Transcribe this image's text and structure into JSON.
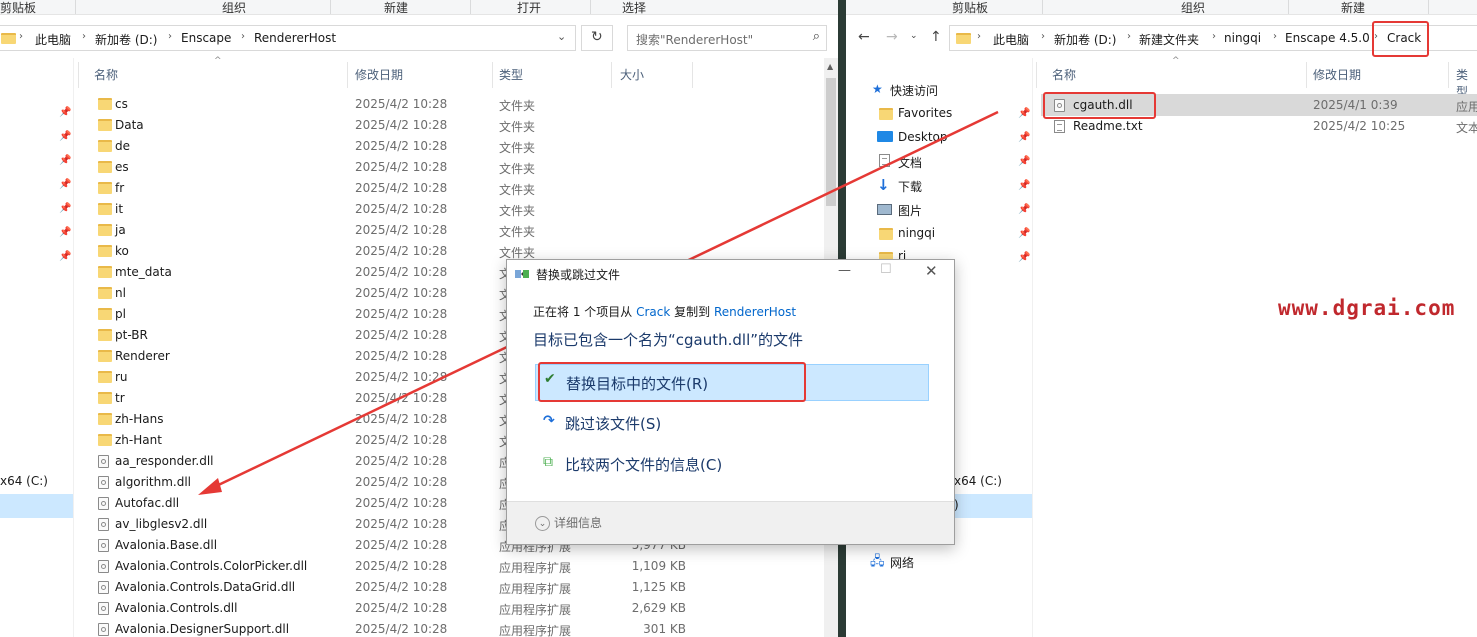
{
  "left_window": {
    "ribbon": [
      "剪贴板",
      "组织",
      "新建",
      "打开",
      "选择"
    ],
    "breadcrumb": [
      "此电脑",
      "新加卷 (D:)",
      "Enscape",
      "RendererHost"
    ],
    "search_placeholder": "搜索\"RendererHost\"",
    "columns": {
      "name": "名称",
      "date": "修改日期",
      "type": "类型",
      "size": "大小"
    },
    "files": [
      {
        "name": "cs",
        "date": "2025/4/2 10:28",
        "type": "文件夹",
        "size": "",
        "kind": "folder"
      },
      {
        "name": "Data",
        "date": "2025/4/2 10:28",
        "type": "文件夹",
        "size": "",
        "kind": "folder"
      },
      {
        "name": "de",
        "date": "2025/4/2 10:28",
        "type": "文件夹",
        "size": "",
        "kind": "folder"
      },
      {
        "name": "es",
        "date": "2025/4/2 10:28",
        "type": "文件夹",
        "size": "",
        "kind": "folder"
      },
      {
        "name": "fr",
        "date": "2025/4/2 10:28",
        "type": "文件夹",
        "size": "",
        "kind": "folder"
      },
      {
        "name": "it",
        "date": "2025/4/2 10:28",
        "type": "文件夹",
        "size": "",
        "kind": "folder"
      },
      {
        "name": "ja",
        "date": "2025/4/2 10:28",
        "type": "文件夹",
        "size": "",
        "kind": "folder"
      },
      {
        "name": "ko",
        "date": "2025/4/2 10:28",
        "type": "文件夹",
        "size": "",
        "kind": "folder"
      },
      {
        "name": "mte_data",
        "date": "2025/4/2 10:28",
        "type": "文件夹",
        "size": "",
        "kind": "folder"
      },
      {
        "name": "nl",
        "date": "2025/4/2 10:28",
        "type": "文",
        "size": "",
        "kind": "folder"
      },
      {
        "name": "pl",
        "date": "2025/4/2 10:28",
        "type": "文",
        "size": "",
        "kind": "folder"
      },
      {
        "name": "pt-BR",
        "date": "2025/4/2 10:28",
        "type": "文",
        "size": "",
        "kind": "folder"
      },
      {
        "name": "Renderer",
        "date": "2025/4/2 10:28",
        "type": "文",
        "size": "",
        "kind": "folder"
      },
      {
        "name": "ru",
        "date": "2025/4/2 10:28",
        "type": "文",
        "size": "",
        "kind": "folder"
      },
      {
        "name": "tr",
        "date": "2025/4/2 10:28",
        "type": "文",
        "size": "",
        "kind": "folder"
      },
      {
        "name": "zh-Hans",
        "date": "2025/4/2 10:28",
        "type": "文",
        "size": "",
        "kind": "folder"
      },
      {
        "name": "zh-Hant",
        "date": "2025/4/2 10:28",
        "type": "文",
        "size": "",
        "kind": "folder"
      },
      {
        "name": "aa_responder.dll",
        "date": "2025/4/2 10:28",
        "type": "应",
        "size": "",
        "kind": "dll"
      },
      {
        "name": "algorithm.dll",
        "date": "2025/4/2 10:28",
        "type": "应",
        "size": "",
        "kind": "dll"
      },
      {
        "name": "Autofac.dll",
        "date": "2025/4/2 10:28",
        "type": "应",
        "size": "",
        "kind": "dll"
      },
      {
        "name": "av_libglesv2.dll",
        "date": "2025/4/2 10:28",
        "type": "应",
        "size": "",
        "kind": "dll"
      },
      {
        "name": "Avalonia.Base.dll",
        "date": "2025/4/2 10:28",
        "type": "应用程序扩展",
        "size": "5,977 KB",
        "kind": "dll"
      },
      {
        "name": "Avalonia.Controls.ColorPicker.dll",
        "date": "2025/4/2 10:28",
        "type": "应用程序扩展",
        "size": "1,109 KB",
        "kind": "dll"
      },
      {
        "name": "Avalonia.Controls.DataGrid.dll",
        "date": "2025/4/2 10:28",
        "type": "应用程序扩展",
        "size": "1,125 KB",
        "kind": "dll"
      },
      {
        "name": "Avalonia.Controls.dll",
        "date": "2025/4/2 10:28",
        "type": "应用程序扩展",
        "size": "2,629 KB",
        "kind": "dll"
      },
      {
        "name": "Avalonia.DesignerSupport.dll",
        "date": "2025/4/2 10:28",
        "type": "应用程序扩展",
        "size": "301 KB",
        "kind": "dll"
      }
    ],
    "drive_label": "x64 (C:)"
  },
  "right_window": {
    "ribbon": [
      "剪贴板",
      "组织",
      "新建"
    ],
    "breadcrumb": [
      "此电脑",
      "新加卷 (D:)",
      "新建文件夹",
      "ningqi",
      "Enscape 4.5.0",
      "Crack"
    ],
    "columns": {
      "name": "名称",
      "date": "修改日期",
      "type": "类型"
    },
    "nav": [
      "快速访问",
      "Favorites",
      "Desktop",
      "文档",
      "下载",
      "图片",
      "ningqi",
      "ri"
    ],
    "files": [
      {
        "name": "cgauth.dll",
        "date": "2025/4/1 0:39",
        "type": "应用",
        "kind": "dll"
      },
      {
        "name": "Readme.txt",
        "date": "2025/4/2 10:25",
        "type": "文本",
        "kind": "txt"
      }
    ],
    "drive_label": "x64 (C:)",
    "drive_selected_tail": ")",
    "network_label": "网络"
  },
  "dialog": {
    "title": "替换或跳过文件",
    "subline_prefix": "正在将 1 个项目从",
    "source": "Crack",
    "subline_middle": "复制到",
    "destination": "RendererHost",
    "heading": "目标已包含一个名为“cgauth.dll”的文件",
    "options": [
      {
        "label": "替换目标中的文件(R)",
        "icon": "check-icon"
      },
      {
        "label": "跳过该文件(S)",
        "icon": "skip-arrow-icon"
      },
      {
        "label": "比较两个文件的信息(C)",
        "icon": "compare-icon"
      }
    ],
    "details": "详细信息"
  },
  "watermark": "www.dgrai.com",
  "colors": {
    "highlight": "#e53935",
    "selection": "#cce8ff",
    "accent_text": "#1b3a6b",
    "link": "#0066cc"
  }
}
